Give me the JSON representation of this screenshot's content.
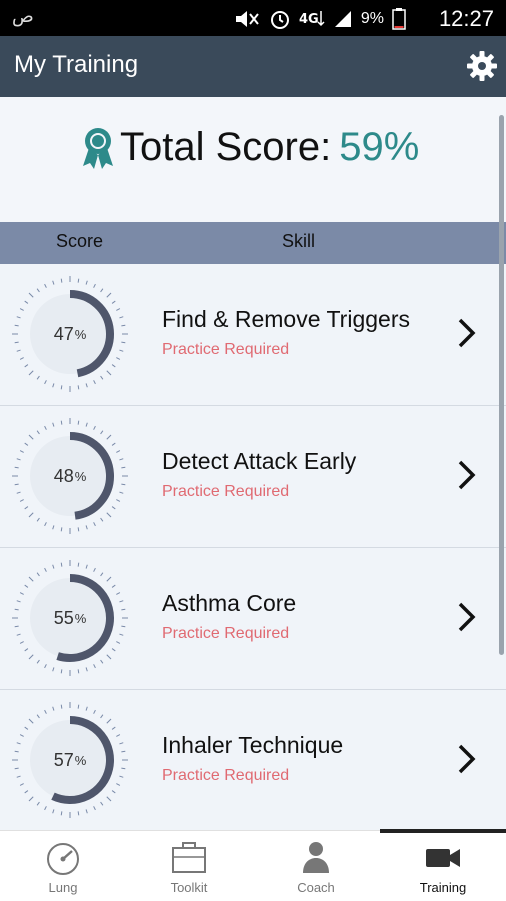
{
  "status_bar": {
    "battery": "9%",
    "time": "12:27"
  },
  "app_bar": {
    "title": "My Training"
  },
  "score_panel": {
    "label": "Total Score:",
    "value": "59%"
  },
  "table_header": {
    "score": "Score",
    "skill": "Skill"
  },
  "skills": [
    {
      "percent": 47,
      "percent_text": "47",
      "name": "Find & Remove Triggers",
      "status": "Practice Required"
    },
    {
      "percent": 48,
      "percent_text": "48",
      "name": "Detect Attack Early",
      "status": "Practice Required"
    },
    {
      "percent": 55,
      "percent_text": "55",
      "name": "Asthma Core",
      "status": "Practice Required"
    },
    {
      "percent": 57,
      "percent_text": "57",
      "name": "Inhaler Technique",
      "status": "Practice Required"
    }
  ],
  "percent_symbol": "%",
  "bottom_nav": [
    {
      "label": "Lung",
      "icon": "gauge-icon",
      "active": false
    },
    {
      "label": "Toolkit",
      "icon": "briefcase-icon",
      "active": false
    },
    {
      "label": "Coach",
      "icon": "person-icon",
      "active": false
    },
    {
      "label": "Training",
      "icon": "video-camera-icon",
      "active": true
    }
  ],
  "colors": {
    "app_bar": "#3a4a5a",
    "accent_score": "#2d8a8a",
    "status_warning": "#e06a72",
    "gauge_arc": "#4f566b",
    "header_row": "#7b8aa7"
  }
}
